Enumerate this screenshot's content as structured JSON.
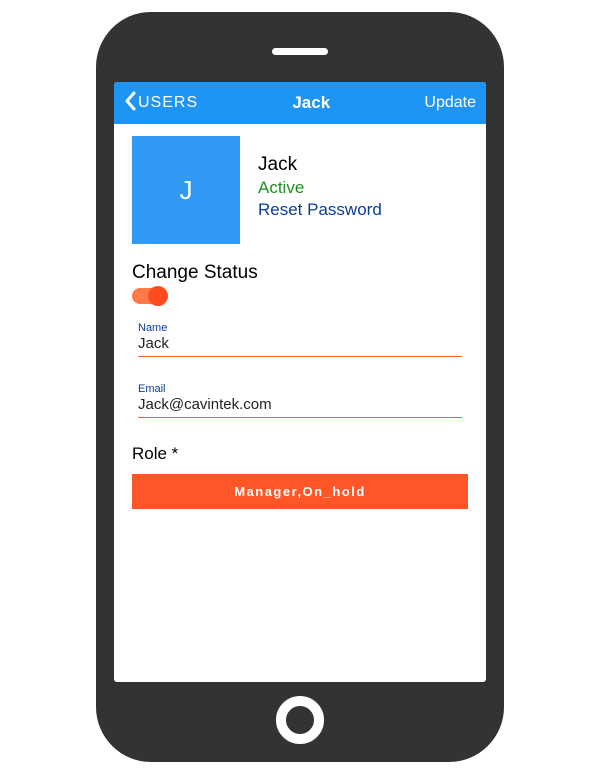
{
  "nav": {
    "back_label": "USERS",
    "title": "Jack",
    "update_label": "Update"
  },
  "profile": {
    "avatar_initial": "J",
    "name": "Jack",
    "status": "Active",
    "reset_label": "Reset Password"
  },
  "change_status": {
    "label": "Change Status",
    "toggle_on": true
  },
  "fields": {
    "name": {
      "label": "Name",
      "value": "Jack"
    },
    "email": {
      "label": "Email",
      "value": "Jack@cavintek.com"
    }
  },
  "role": {
    "label": "Role *",
    "button_label": "Manager,On_hold"
  },
  "colors": {
    "primary": "#1E94F4",
    "accent": "#FF5527",
    "status_active": "#1E8F1E",
    "link": "#0B3D91"
  }
}
